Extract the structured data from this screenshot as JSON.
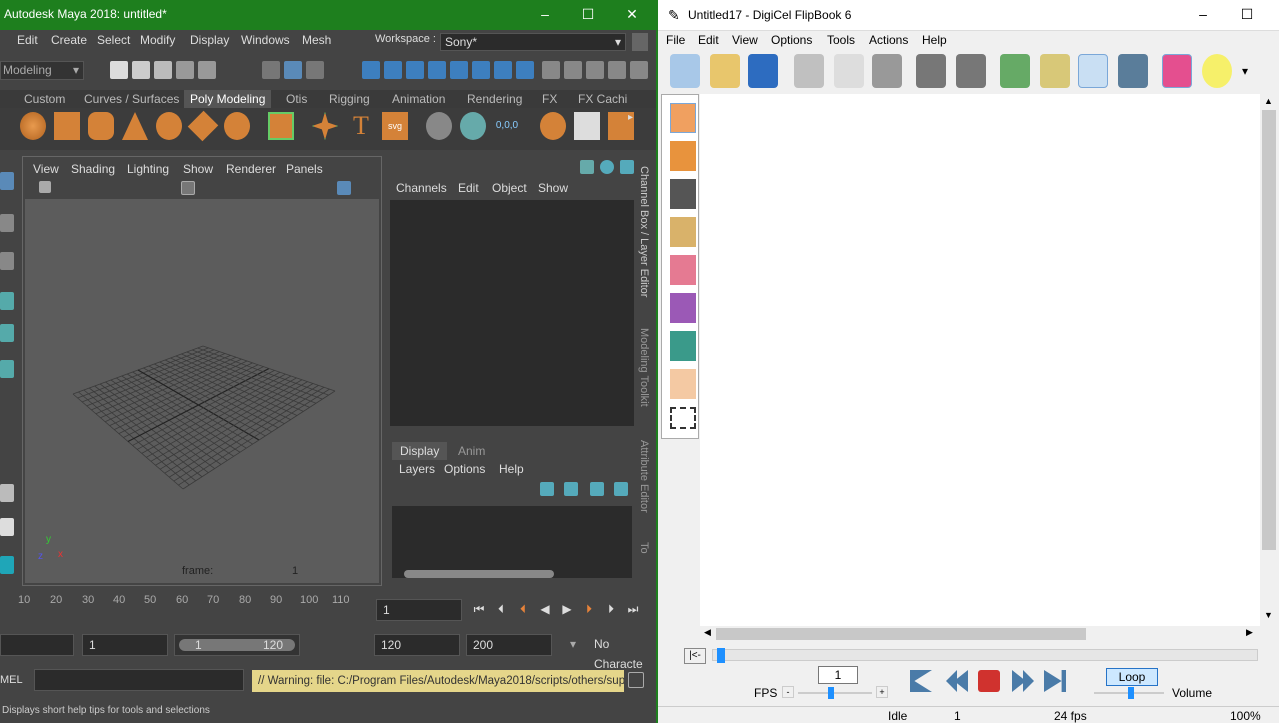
{
  "maya": {
    "title": "Autodesk Maya 2018: untitled*",
    "window_controls": [
      "–",
      "☐",
      "✕"
    ],
    "menus": [
      "Edit",
      "Create",
      "Select",
      "Modify",
      "Display",
      "Windows",
      "Mesh"
    ],
    "workspace_label": "Workspace :",
    "workspace_value": "Sony*",
    "mode": "Modeling",
    "shelf_tabs": [
      "Custom",
      "Curves / Surfaces",
      "Poly Modeling",
      "Otis",
      "Rigging",
      "Animation",
      "Rendering",
      "FX",
      "FX Cachi"
    ],
    "active_shelf": "Poly Modeling",
    "viewport_menus": [
      "View",
      "Shading",
      "Lighting",
      "Show",
      "Renderer",
      "Panels"
    ],
    "viewport_frame_label": "frame:",
    "viewport_frame_value": "1",
    "axis_labels": {
      "x": "x",
      "y": "y",
      "z": "z"
    },
    "channel_menus": [
      "Channels",
      "Edit",
      "Object",
      "Show"
    ],
    "layer_tabs": [
      "Display",
      "Anim"
    ],
    "layer_menus": [
      "Layers",
      "Options",
      "Help"
    ],
    "side_tabs": [
      "Channel Box / Layer Editor",
      "Modeling Toolkit",
      "Attribute Editor",
      "To"
    ],
    "timeline_ticks": [
      "10",
      "20",
      "30",
      "40",
      "50",
      "60",
      "70",
      "80",
      "90",
      "100",
      "110"
    ],
    "current_frame": "1",
    "range_start": "1",
    "range_slider_start": "1",
    "range_slider_end": "120",
    "range_end": "120",
    "anim_end": "200",
    "character_set": "No Characte",
    "mel_label": "MEL",
    "warning": "// Warning: file: C:/Program Files/Autodesk/Maya2018/scripts/others/supp",
    "help_line": "Displays short help tips for tools and selections"
  },
  "flipbook": {
    "title": "Untitled17 - DigiCel FlipBook 6",
    "window_controls": [
      "–",
      "☐"
    ],
    "menus": [
      "File",
      "Edit",
      "View",
      "Options",
      "Tools",
      "Actions",
      "Help"
    ],
    "frame_number": "1",
    "fps_label": "FPS",
    "fps_minus": "-",
    "fps_plus": "+",
    "loop_label": "Loop",
    "volume_label": "Volume",
    "start_button": "|<-",
    "status": {
      "state": "Idle",
      "frame": "1",
      "fps": "24 fps",
      "zoom": "100%"
    }
  }
}
